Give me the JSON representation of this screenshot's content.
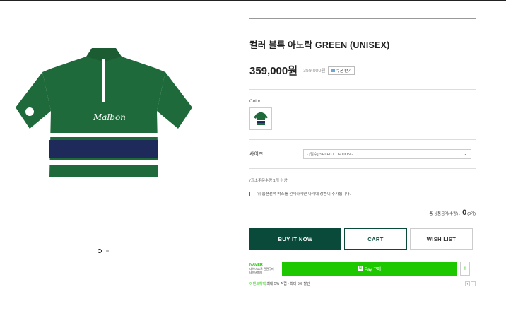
{
  "product": {
    "title": "컬러 블록 아노락 GREEN (UNISEX)",
    "price": "359,000원",
    "original_price": "359,000원",
    "coupon_label": "쿠폰 받기",
    "color_label": "Color",
    "size_label": "사이즈",
    "size_select_value": "- [필수] SELECT OPTION -",
    "min_qty": "(최소주문수량 1개 이상)",
    "notice": "위 옵션선택 박스를 선택하시면 아래에 상품이 추가됩니다.",
    "total_label": "총 상품금액(수량) :",
    "total_value": "0",
    "total_unit": "(0개)"
  },
  "buttons": {
    "buy_now": "BUY IT NOW",
    "cart": "CART",
    "wish": "WISH LIST"
  },
  "npay": {
    "brand": "NAVER",
    "desc_line1": "네이버ID로 간편구매",
    "desc_line2": "네이버페이",
    "pay_label": "Pay 구매",
    "n_badge": "N",
    "side_label": "찜",
    "bottom_text_green": "이벤트혜택",
    "bottom_text": "최대 5% 적립 · 최대 5% 할인"
  },
  "gallery": {
    "image_alt": "green color block anorak shirt",
    "active_slide": 1,
    "slide_count": 2
  },
  "colors": {
    "primary": "#0a4a3a",
    "naver_green": "#1ec800",
    "shirt_green": "#1e6a3a",
    "shirt_navy": "#1e2a5a"
  }
}
